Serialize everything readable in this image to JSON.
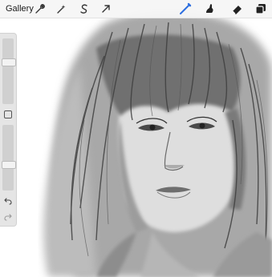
{
  "toolbar": {
    "gallery_label": "Gallery",
    "left_tools": [
      "wrench-icon",
      "magic-wand-icon",
      "selection-s-icon",
      "transform-arrow-icon"
    ],
    "right_tools": [
      "brush-icon",
      "smudge-icon",
      "eraser-icon",
      "layers-icon"
    ],
    "active_tool": "brush-icon",
    "active_color": "#2d6fe0"
  },
  "sidebar": {
    "brush_size_level": 0.15,
    "opacity_level": 0.55,
    "controls": [
      "brush-size-slider",
      "modify-button",
      "opacity-slider",
      "undo-button",
      "redo-button"
    ]
  },
  "canvas": {
    "artwork_description_visible": false
  }
}
